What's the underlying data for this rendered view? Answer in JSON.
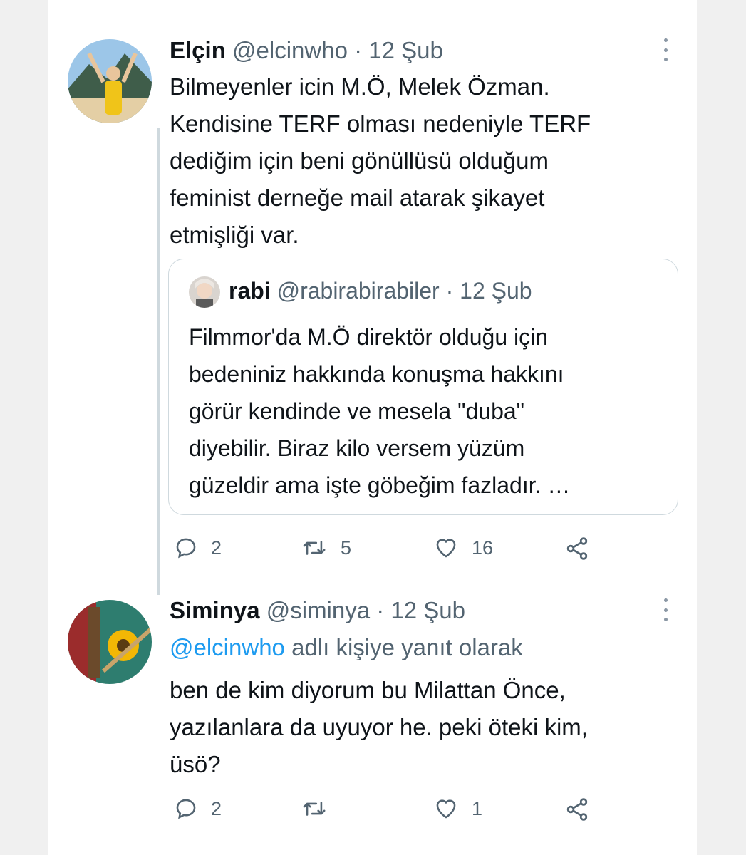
{
  "tweet1": {
    "name": "Elçin",
    "handle": "@elcinwho",
    "date": "· 12 Şub",
    "lines": [
      "Bilmeyenler icin M.Ö, Melek Özman.",
      "Kendisine TERF olması nedeniyle TERF",
      "dediğim için beni gönüllüsü olduğum",
      "feminist derneğe mail atarak şikayet",
      "etmişliği var."
    ],
    "quote": {
      "name": "rabi",
      "handle": "@rabirabirabiler",
      "date": "· 12 Şub",
      "lines": [
        "Filmmor'da M.Ö direktör olduğu için",
        "bedeniniz hakkında konuşma hakkını",
        "görür kendinde ve mesela \"duba\"",
        "diyebilir.  Biraz kilo versem yüzüm",
        "güzeldir ama işte göbeğim fazladır.  …"
      ]
    },
    "actions": {
      "replies": "2",
      "retweets": "5",
      "likes": "16"
    }
  },
  "tweet2": {
    "name": "Siminya",
    "handle": "@siminya",
    "date": "· 12 Şub",
    "reply_handle": "@elcinwho",
    "reply_text": " adlı kişiye yanıt olarak",
    "lines": [
      "ben de kim diyorum bu Milattan Önce,",
      "yazılanlara da uyuyor he. peki öteki kim,",
      "üsö?"
    ],
    "actions": {
      "replies": "2",
      "retweets": "",
      "likes": "1"
    }
  },
  "colors": {
    "accent": "#1d9bf0",
    "muted": "#536471",
    "text": "#0f1419"
  },
  "icons": [
    "reply-icon",
    "retweet-icon",
    "like-icon",
    "share-icon",
    "more-icon"
  ]
}
